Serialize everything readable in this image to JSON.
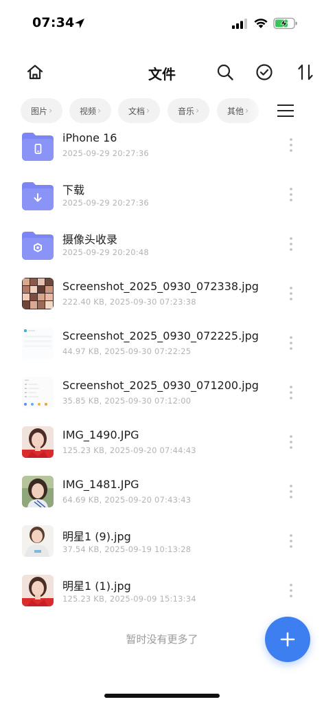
{
  "status_bar": {
    "time": "07:34"
  },
  "header": {
    "title": "文件"
  },
  "categories": [
    {
      "label": "图片"
    },
    {
      "label": "视频"
    },
    {
      "label": "文档"
    },
    {
      "label": "音乐"
    },
    {
      "label": "其他"
    }
  ],
  "files": [
    {
      "name": "iPhone 16",
      "meta": "2025-09-29 20:27:36",
      "type": "folder",
      "icon": "phone-glyph-icon"
    },
    {
      "name": "下载",
      "meta": "2025-09-29 20:27:36",
      "type": "folder",
      "icon": "download-glyph-icon"
    },
    {
      "name": "摄像头收录",
      "meta": "2025-09-29 20:20:48",
      "type": "folder",
      "icon": "camera-glyph-icon"
    },
    {
      "name": "Screenshot_2025_0930_072338.jpg",
      "meta": "222.40 KB, 2025-09-30 07:23:38",
      "type": "image"
    },
    {
      "name": "Screenshot_2025_0930_072225.jpg",
      "meta": "44.97 KB, 2025-09-30 07:22:25",
      "type": "image"
    },
    {
      "name": "Screenshot_2025_0930_071200.jpg",
      "meta": "35.85 KB, 2025-09-30 07:12:00",
      "type": "image"
    },
    {
      "name": "IMG_1490.JPG",
      "meta": "125.23 KB, 2025-09-20 07:44:43",
      "type": "image"
    },
    {
      "name": "IMG_1481.JPG",
      "meta": "64.69 KB, 2025-09-20 07:43:43",
      "type": "image"
    },
    {
      "name": "明星1 (9).jpg",
      "meta": "37.54 KB, 2025-09-19 10:13:28",
      "type": "image"
    },
    {
      "name": "明星1 (1).jpg",
      "meta": "125.23 KB, 2025-09-09 15:13:34",
      "type": "image"
    }
  ],
  "footer": {
    "end_text": "暂时没有更多了"
  },
  "colors": {
    "accent": "#3d7ef0",
    "folder": "#7b86f4"
  }
}
